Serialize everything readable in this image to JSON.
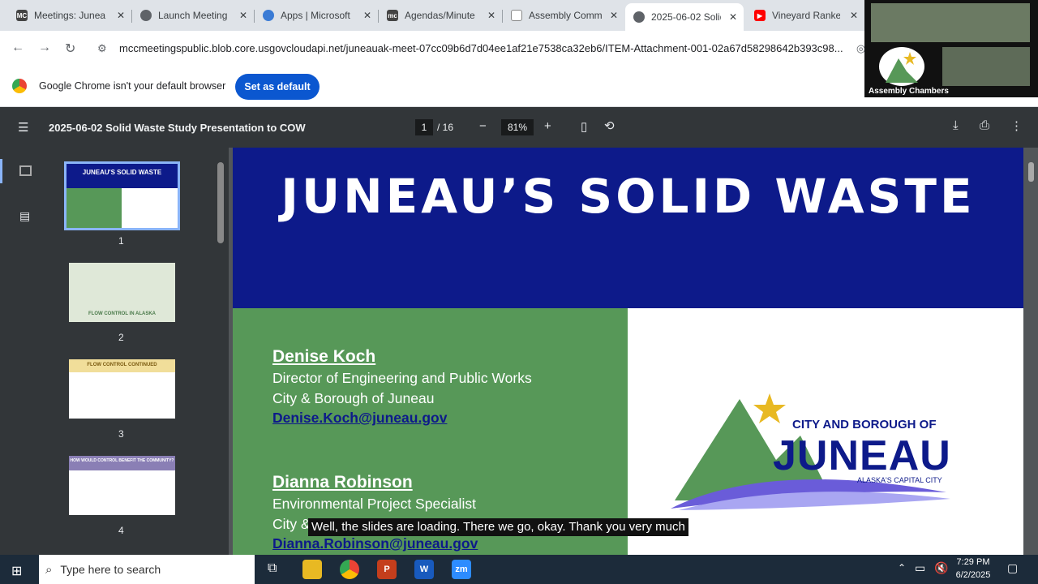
{
  "tabs": [
    {
      "title": "Meetings: Junea",
      "fav": "MC",
      "color": "#444"
    },
    {
      "title": "Launch Meeting",
      "fav": "",
      "color": "#5f6368"
    },
    {
      "title": "Apps | Microsoft",
      "fav": "",
      "color": "#3a7bd5"
    },
    {
      "title": "Agendas/Minute",
      "fav": "mc",
      "color": "#444"
    },
    {
      "title": "Assembly Comm",
      "fav": "",
      "color": "#888"
    },
    {
      "title": "2025-06-02 Solid",
      "fav": "",
      "color": "#5f6368"
    },
    {
      "title": "Vineyard Ranked",
      "fav": "",
      "color": "#ff0000"
    }
  ],
  "url": "mccmeetingspublic.blob.core.usgovcloudapi.net/juneauak-meet-07cc09b6d7d04ee1af21e7538ca32eb6/ITEM-Attachment-001-02a67d58298642b393c98...",
  "infobar": {
    "message": "Google Chrome isn't your default browser",
    "button": "Set as default"
  },
  "pdf": {
    "title": "2025-06-02 Solid Waste Study Presentation to COW",
    "page": "1",
    "total": "/ 16",
    "zoom": "81%"
  },
  "thumbnails": [
    {
      "num": "1",
      "title": "JUNEAU'S SOLID WASTE"
    },
    {
      "num": "2",
      "title": "FLOW CONTROL IN ALASKA"
    },
    {
      "num": "3",
      "title": "FLOW CONTROL CONTINUED"
    },
    {
      "num": "4",
      "title": "HOW WOULD CONTROL BENEFIT THE COMMUNITY?"
    }
  ],
  "slide": {
    "title": "JUNEAU’S SOLID WASTE",
    "p1_name": "Denise Koch",
    "p1_role": "Director of Engineering and Public Works",
    "p1_org": "City & Borough of Juneau",
    "p1_email": "Denise.Koch@juneau.gov",
    "p2_name": "Dianna Robinson",
    "p2_role": "Environmental Project Specialist",
    "p2_org": "City &",
    "p2_email": "Dianna.Robinson@juneau.gov",
    "logo_top": "CITY AND BOROUGH OF",
    "logo_main": "JUNEAU",
    "logo_sub": "ALASKA'S CAPITAL CITY"
  },
  "caption": "Well, the slides are loading. There we go, okay. Thank you very much",
  "taskbar": {
    "search_placeholder": "Type here to search",
    "time": "7:29 PM",
    "date": "6/2/2025"
  },
  "video": {
    "label": "Assembly Chambers"
  }
}
